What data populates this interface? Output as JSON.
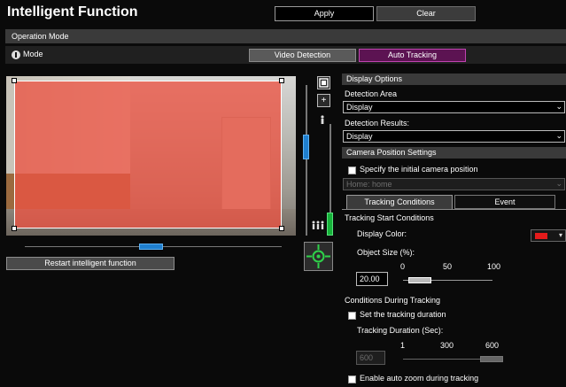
{
  "header": {
    "title": "Intelligent Function",
    "apply_label": "Apply",
    "clear_label": "Clear"
  },
  "section": {
    "title": "Operation Mode"
  },
  "mode": {
    "label": "Mode",
    "options": [
      {
        "label": "Video Detection",
        "selected": false
      },
      {
        "label": "Auto Tracking",
        "selected": true
      }
    ]
  },
  "video": {
    "restart_label": "Restart intelligent function",
    "overlay_color": "#ec5342",
    "zoom_out_glyph": "+",
    "pan_position": 0.54,
    "upper_slider_position": 0.28,
    "lower_slider_position": 0.87
  },
  "panel": {
    "display_options": {
      "title": "Display Options",
      "detection_area_label": "Detection Area",
      "detection_area_value": "Display",
      "detection_results_label": "Detection Results:",
      "detection_results_value": "Display"
    },
    "camera_position": {
      "title": "Camera Position Settings",
      "specify_label": "Specify the initial camera position",
      "specify_checked": false,
      "home_value": "Home: home"
    },
    "tabs": [
      {
        "label": "Tracking Conditions",
        "active": true
      },
      {
        "label": "Event",
        "active": false
      }
    ],
    "tracking_start": {
      "title": "Tracking Start Conditions",
      "display_color_label": "Display Color:",
      "display_color": "#e41b1b",
      "object_size_label": "Object Size (%):",
      "object_size_ticks": [
        "0",
        "50",
        "100"
      ],
      "object_size_value": "20.00"
    },
    "during_tracking": {
      "title": "Conditions During Tracking",
      "duration_check_label": "Set the tracking duration",
      "duration_checked": false,
      "duration_label": "Tracking Duration (Sec):",
      "duration_ticks": [
        "1",
        "300",
        "600"
      ],
      "duration_value": "600",
      "auto_zoom_label": "Enable auto zoom during tracking",
      "auto_zoom_checked": false
    }
  }
}
